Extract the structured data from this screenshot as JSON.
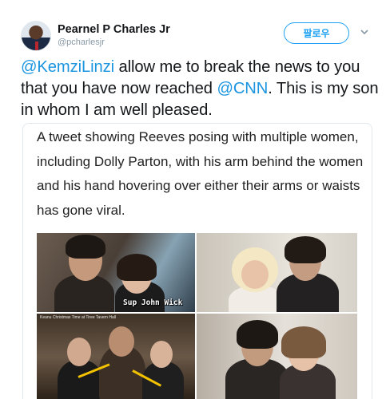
{
  "author": {
    "name": "Pearnel P Charles Jr",
    "handle": "@pcharlesjr"
  },
  "actions": {
    "follow_label": "팔로우",
    "menu_icon": "chevron-down-icon"
  },
  "tweet": {
    "mention_1": "@KemziLinzi",
    "text_1": " allow me to break the news to you that you have now reached ",
    "mention_2": "@CNN",
    "text_2": ".  This is my son in whom I am well pleased."
  },
  "card": {
    "caption": "A tweet showing Reeves posing with multiple women, including Dolly Parton, with his arm behind the women and his hand hovering over either their arms or waists has gone viral.",
    "photo_1_overlay": "Sup John Wick",
    "photo_3_overlay": "Keanu Christmas Time at Tiree Tavern Hall",
    "info_icon": "info-icon"
  },
  "colors": {
    "link": "#1b95e0",
    "follow_border": "#1da1f2",
    "secondary_text": "#8899a6",
    "arrow": "#f2c200"
  }
}
